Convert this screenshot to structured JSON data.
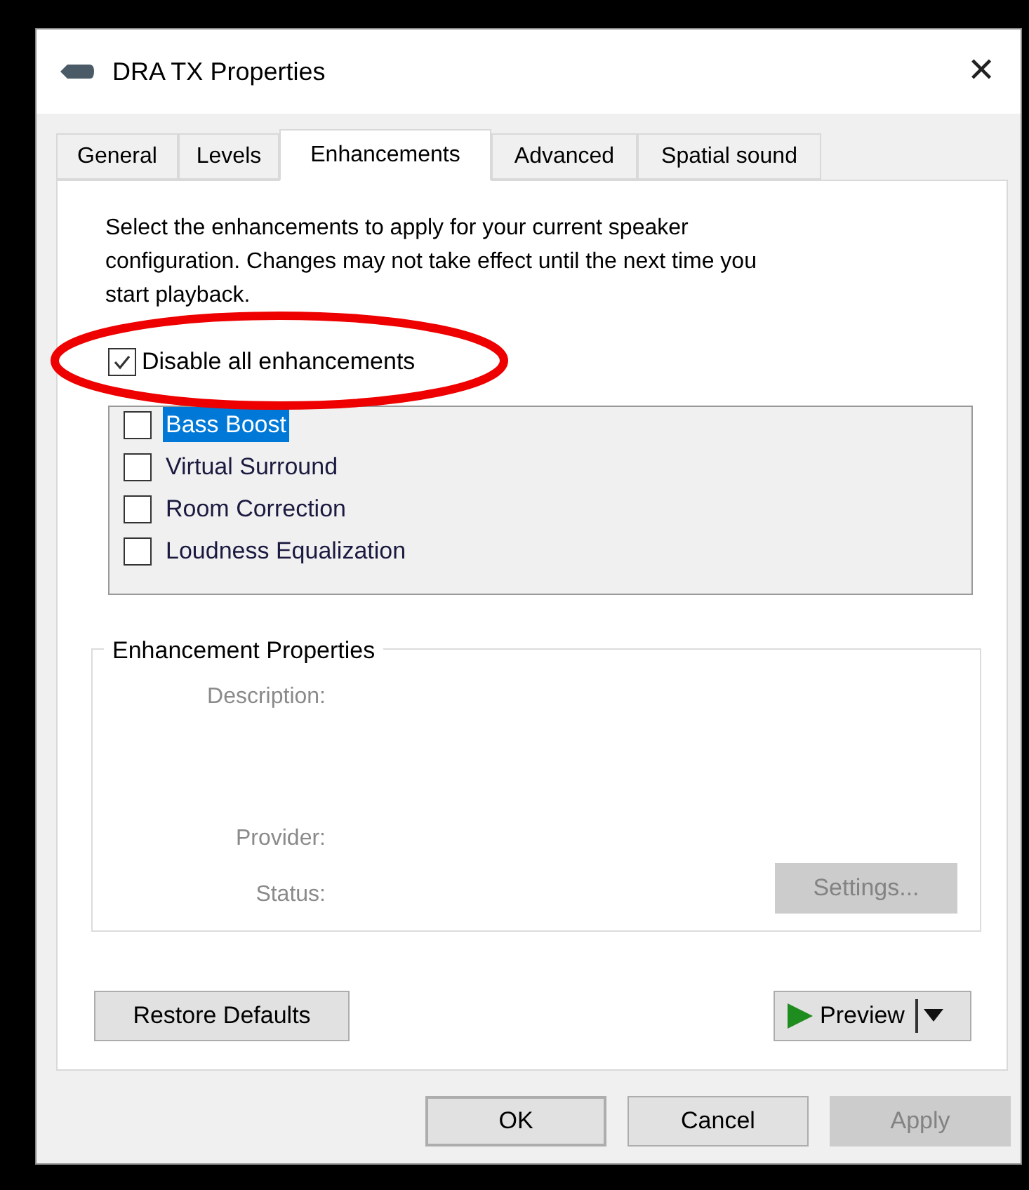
{
  "window": {
    "title": "DRA TX Properties",
    "close": "✕"
  },
  "tabs": [
    {
      "label": "General",
      "selected": false
    },
    {
      "label": "Levels",
      "selected": false
    },
    {
      "label": "Enhancements",
      "selected": true
    },
    {
      "label": "Advanced",
      "selected": false
    },
    {
      "label": "Spatial sound",
      "selected": false
    }
  ],
  "intro": "Select the enhancements to apply for your current speaker configuration. Changes may not take effect until the next time you start playback.",
  "disable_all": {
    "label": "Disable all enhancements",
    "checked": true
  },
  "enhancements": [
    {
      "label": "Bass Boost",
      "checked": false,
      "selected": true
    },
    {
      "label": "Virtual Surround",
      "checked": false,
      "selected": false
    },
    {
      "label": "Room Correction",
      "checked": false,
      "selected": false
    },
    {
      "label": "Loudness Equalization",
      "checked": false,
      "selected": false
    }
  ],
  "properties": {
    "title": "Enhancement Properties",
    "labels": [
      {
        "text": "Description:",
        "disabled": true
      },
      {
        "text": "Provider:",
        "disabled": true
      },
      {
        "text": "Status:",
        "disabled": true
      }
    ],
    "settings": {
      "label": "Settings...",
      "disabled": true
    }
  },
  "restore_defaults": {
    "label": "Restore Defaults",
    "disabled": false
  },
  "preview": {
    "label": "Preview"
  },
  "buttons": [
    {
      "label": "OK",
      "default": true,
      "disabled": false
    },
    {
      "label": "Cancel",
      "default": false,
      "disabled": false
    },
    {
      "label": "Apply",
      "default": false,
      "disabled": true
    }
  ]
}
